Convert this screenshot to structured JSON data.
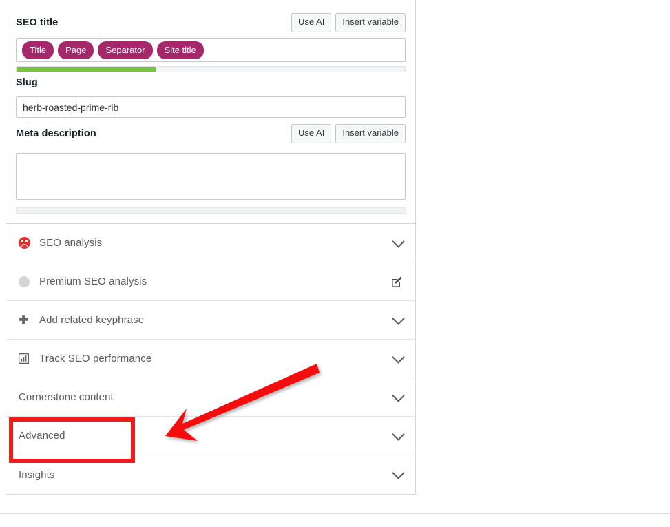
{
  "panel": {
    "seo_title": {
      "label": "SEO title",
      "use_ai_label": "Use AI",
      "insert_variable_label": "Insert variable",
      "pills": [
        "Title",
        "Page",
        "Separator",
        "Site title"
      ],
      "progress_percent": 36,
      "progress_color": "#7ac143",
      "pill_color": "#a4286a"
    },
    "slug": {
      "label": "Slug",
      "value": "herb-roasted-prime-rib",
      "placeholder": ""
    },
    "meta_description": {
      "label": "Meta description",
      "use_ai_label": "Use AI",
      "insert_variable_label": "Insert variable",
      "value": "",
      "placeholder": "",
      "progress_percent": 0
    }
  },
  "accordion": {
    "items": [
      {
        "label": "SEO analysis",
        "icon": "sad-face-icon",
        "right_icon": "chevron-down-icon"
      },
      {
        "label": "Premium SEO analysis",
        "icon": "gray-dot-icon",
        "right_icon": "edit-pencil-icon"
      },
      {
        "label": "Add related keyphrase",
        "icon": "plus-icon",
        "right_icon": "chevron-down-icon"
      },
      {
        "label": "Track SEO performance",
        "icon": "bar-chart-icon",
        "right_icon": "chevron-down-icon"
      },
      {
        "label": "Cornerstone content",
        "icon": "",
        "right_icon": "chevron-down-icon"
      },
      {
        "label": "Advanced",
        "icon": "",
        "right_icon": "chevron-down-icon"
      },
      {
        "label": "Insights",
        "icon": "",
        "right_icon": "chevron-down-icon"
      }
    ]
  },
  "annotations": {
    "highlight_color": "#ee1c1c",
    "highlight_target": "Advanced",
    "arrow_points_to": "Advanced"
  }
}
